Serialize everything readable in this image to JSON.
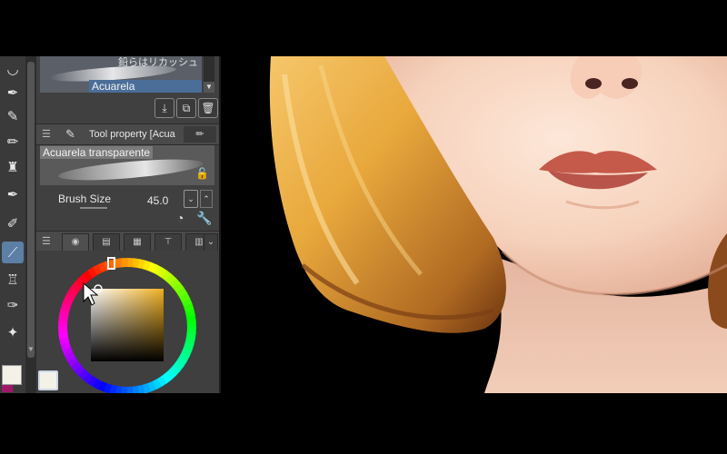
{
  "toolbar": {
    "tools": [
      {
        "icon": "blend-icon"
      },
      {
        "icon": "pen-icon"
      },
      {
        "icon": "marker-icon"
      },
      {
        "icon": "pencil-icon"
      },
      {
        "icon": "airbrush-icon"
      },
      {
        "icon": "pen-nib-icon"
      },
      {
        "icon": "brush-icon"
      },
      {
        "icon": "watercolor-brush-icon",
        "active": true
      },
      {
        "icon": "eraser-icon"
      },
      {
        "icon": "fill-icon"
      },
      {
        "icon": "sparkle-icon"
      }
    ]
  },
  "subtool": {
    "top_label": "鉛らはリカッシュ",
    "selected_name": "Acuarela transparente"
  },
  "tool_property": {
    "title": "Tool property [Acua",
    "preview_label": "Acuarela transparente",
    "brush_size_label": "Brush Size",
    "brush_size_value": "45.0"
  },
  "color_wheel": {
    "main_color": "#f4f1e8",
    "sub_color": "#a0176a"
  },
  "colors": {
    "panel_bg": "#404040",
    "selection": "#4b6e99",
    "hair": "#e8a83c",
    "skin": "#f6d2bc",
    "lips": "#c65a4a"
  }
}
